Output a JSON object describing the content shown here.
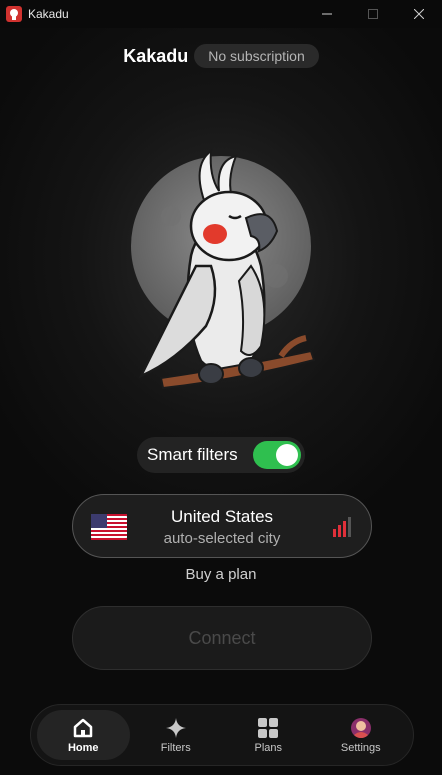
{
  "window": {
    "title": "Kakadu"
  },
  "header": {
    "brand": "Kakadu",
    "subscription_status": "No subscription"
  },
  "smart_filters": {
    "label": "Smart filters",
    "enabled": true,
    "toggle_color": "#2fbf4f"
  },
  "location": {
    "country": "United States",
    "city": "auto-selected city",
    "flag_icon": "us-flag-icon",
    "signal_icon": "signal-strength-icon",
    "signal_color": "#e0303a"
  },
  "buy_plan_label": "Buy a plan",
  "connect_label": "Connect",
  "nav": {
    "items": [
      {
        "label": "Home",
        "icon": "home-icon",
        "active": true
      },
      {
        "label": "Filters",
        "icon": "sparkle-icon",
        "active": false
      },
      {
        "label": "Plans",
        "icon": "grid-icon",
        "active": false
      },
      {
        "label": "Settings",
        "icon": "avatar-icon",
        "active": false
      }
    ]
  }
}
